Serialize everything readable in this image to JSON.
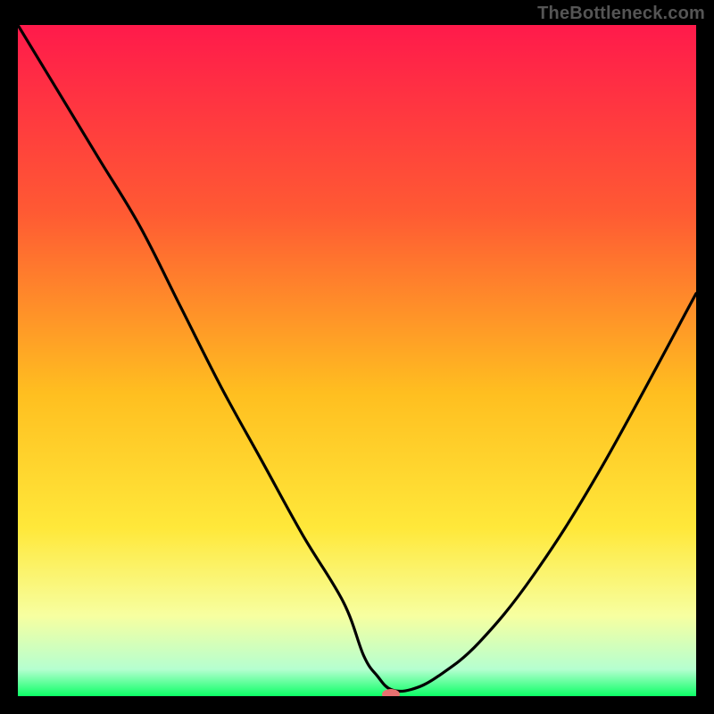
{
  "watermark": "TheBottleneck.com",
  "chart_data": {
    "type": "line",
    "title": "",
    "xlabel": "",
    "ylabel": "",
    "xlim": [
      0,
      100
    ],
    "ylim": [
      0,
      100
    ],
    "grid": false,
    "legend": false,
    "background_gradient": {
      "stops": [
        {
          "offset": 0,
          "color": "#ff1a4b"
        },
        {
          "offset": 28,
          "color": "#ff5a33"
        },
        {
          "offset": 55,
          "color": "#ffbf20"
        },
        {
          "offset": 75,
          "color": "#ffe83a"
        },
        {
          "offset": 88,
          "color": "#f7ffa0"
        },
        {
          "offset": 96,
          "color": "#b5ffd0"
        },
        {
          "offset": 100,
          "color": "#0cff66"
        }
      ]
    },
    "series": [
      {
        "name": "bottleneck-curve",
        "x": [
          0,
          6,
          12,
          18,
          24,
          30,
          36,
          42,
          48,
          51,
          53,
          55,
          58,
          62,
          68,
          76,
          86,
          100
        ],
        "y": [
          100,
          90,
          80,
          70,
          58,
          46,
          35,
          24,
          14,
          6,
          3,
          1,
          1,
          3,
          8,
          18,
          34,
          60
        ]
      }
    ],
    "marker": {
      "name": "bottleneck-marker",
      "x": 55,
      "y": 0,
      "color": "#e97070",
      "rx": 10,
      "ry": 6
    }
  }
}
